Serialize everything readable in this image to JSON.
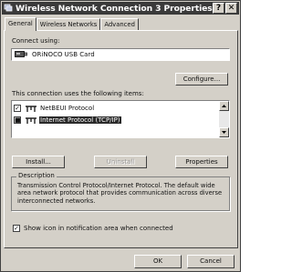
{
  "window": {
    "title": "Wireless Network Connection 3 Properties",
    "help_btn": "?",
    "close_btn": "✕"
  },
  "tabs": [
    {
      "label": "General"
    },
    {
      "label": "Wireless Networks"
    },
    {
      "label": "Advanced"
    }
  ],
  "connect_using": {
    "label": "Connect using:",
    "adapter": "ORiNOCO USB Card",
    "configure_label": "Configure..."
  },
  "items": {
    "label": "This connection uses the following items:",
    "list": [
      {
        "label": "NetBEUI Protocol",
        "checked": true,
        "mark": "✓",
        "selected": false
      },
      {
        "label": "Internet Protocol (TCP/IP)",
        "checked": true,
        "mark": "■",
        "selected": true
      }
    ]
  },
  "buttons": {
    "install": "Install...",
    "uninstall": "Uninstall",
    "properties": "Properties"
  },
  "description": {
    "title": "Description",
    "text": "Transmission Control Protocol/Internet Protocol. The default wide area network protocol that provides communication across diverse interconnected networks."
  },
  "show_icon": {
    "label": "Show icon in notification area when connected",
    "checked": true,
    "mark": "✓"
  },
  "footer": {
    "ok": "OK",
    "cancel": "Cancel"
  }
}
